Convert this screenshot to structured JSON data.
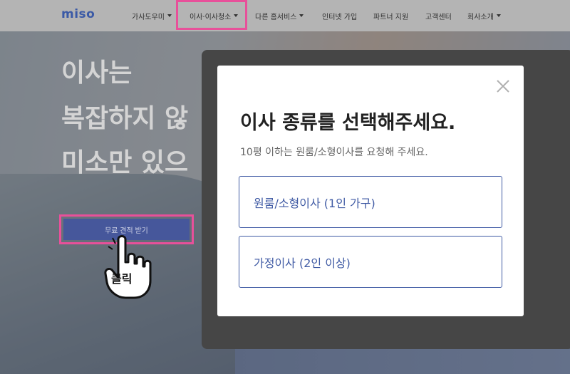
{
  "nav": {
    "logo": "miso",
    "items": [
      {
        "label": "가사도우미",
        "dropdown": true
      },
      {
        "label": "이사·이사청소",
        "dropdown": true
      },
      {
        "label": "다른 홈서비스",
        "dropdown": true
      },
      {
        "label": "인터넷 가입",
        "dropdown": false
      },
      {
        "label": "파트너 지원",
        "dropdown": false
      },
      {
        "label": "고객센터",
        "dropdown": false
      },
      {
        "label": "회사소개",
        "dropdown": true
      }
    ]
  },
  "hero": {
    "line1": "이사는",
    "line2": "복잡하지 않",
    "line3": "미소만 있으",
    "cta_label": "무료 견적 받기"
  },
  "annotation": {
    "click_label": "클릭",
    "highlight_color": "#e8509a"
  },
  "modal": {
    "title": "이사 종류를 선택해주세요.",
    "subtitle": "10평 이하는 원룸/소형이사를 요청해 주세요.",
    "options": [
      {
        "label": "원룸/소형이사 (1인 가구)"
      },
      {
        "label": "가정이사 (2인 이상)"
      }
    ]
  },
  "colors": {
    "brand": "#3b5aa6",
    "cta": "#46579b",
    "nav_bg": "#b4b4b4"
  }
}
